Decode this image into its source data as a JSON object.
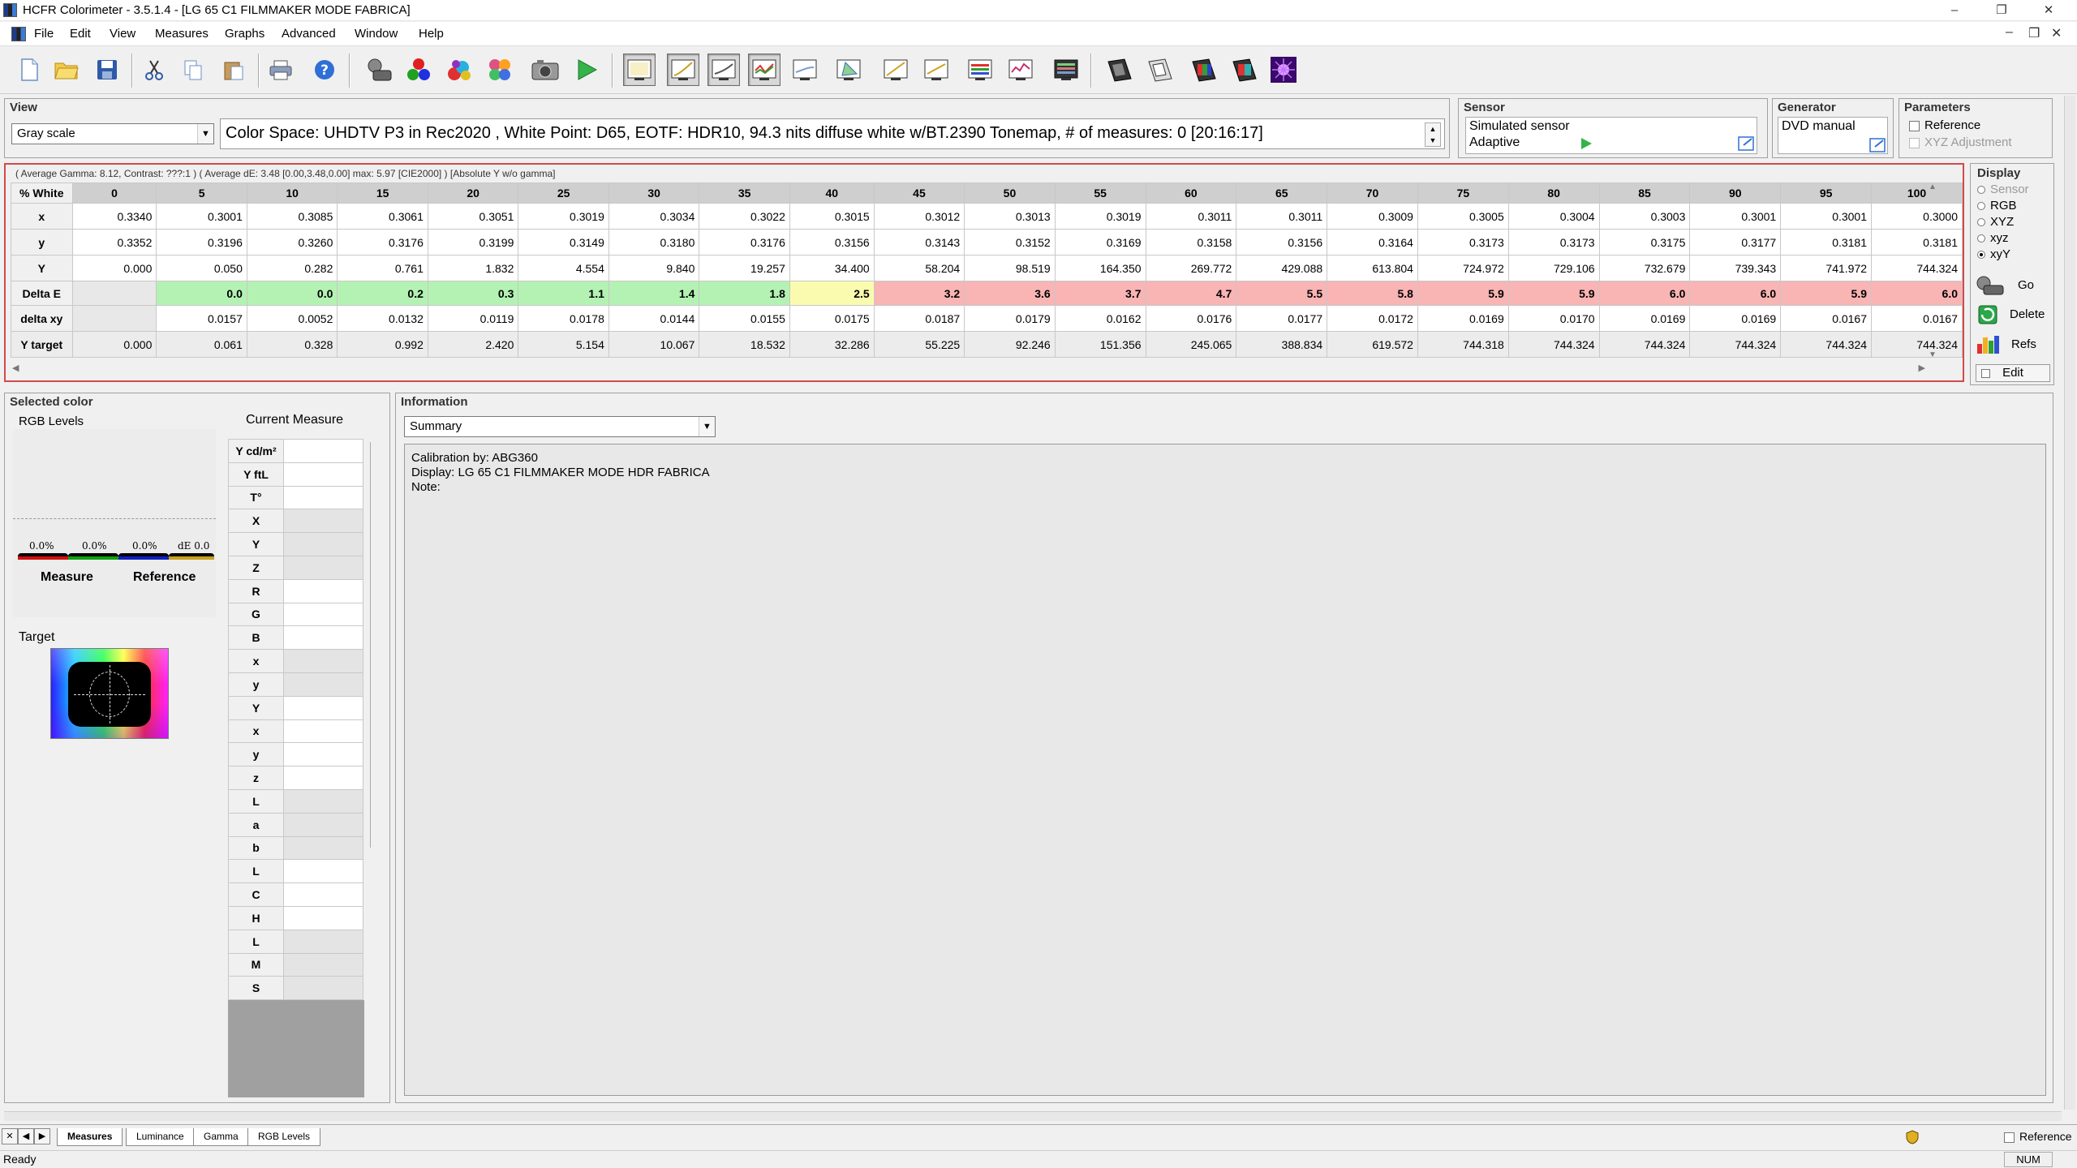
{
  "window": {
    "title": "HCFR Colorimeter - 3.5.1.4 - [LG 65 C1 FILMMAKER MODE FABRICA]",
    "controls": [
      "–",
      "❐",
      "✕"
    ]
  },
  "menu": {
    "items": [
      "File",
      "Edit",
      "View",
      "Measures",
      "Graphs",
      "Advanced",
      "Window",
      "Help"
    ],
    "mdi_controls": [
      "–",
      "❐",
      "✕"
    ]
  },
  "toolbar": {
    "buttons": [
      "new-icon",
      "open-icon",
      "save-icon",
      "cut-icon",
      "copy-icon",
      "paste-icon",
      "print-icon",
      "help-icon",
      "sensor-icon",
      "rgb-circles-icon",
      "color-pattern-icon",
      "saturation-icon",
      "camera-icon",
      "play-icon",
      "gray-scale-view-icon",
      "gamma-view-icon",
      "luminance-view-icon",
      "rgb-levels-view-icon",
      "color-temp-view-icon",
      "cie-chart-view-icon",
      "near-black-view-icon",
      "near-white-view-icon",
      "saturation-luma-view-icon",
      "saturation-shift-view-icon",
      "measures-combo-icon",
      "film-icon-1",
      "film-icon-2",
      "film-icon-3",
      "film-icon-4",
      "purple-burst-icon"
    ]
  },
  "view_panel": {
    "title": "View",
    "selection": "Gray scale",
    "colorspace_text": "Color Space: UHDTV P3 in Rec2020 , White Point: D65, EOTF:  HDR10, 94.3 nits diffuse white w/BT.2390 Tonemap, # of measures: 0 [20:16:17]"
  },
  "sensor_panel": {
    "title": "Sensor",
    "sensor_name": "Simulated sensor",
    "mode": "Adaptive"
  },
  "generator_panel": {
    "title": "Generator",
    "generator_name": "DVD manual"
  },
  "params_panel": {
    "title": "Parameters",
    "reference_label": "Reference",
    "xyz_adjust_label": "XYZ Adjustment"
  },
  "grid": {
    "stats": "( Average Gamma: 8.12, Contrast: ???:1 ) ( Average dE: 3.48 [0.00,3.48,0.00] max: 5.97 [CIE2000] ) [Absolute Y w/o gamma]",
    "header_label": "% White",
    "columns": [
      "0",
      "5",
      "10",
      "15",
      "20",
      "25",
      "30",
      "35",
      "40",
      "45",
      "50",
      "55",
      "60",
      "65",
      "70",
      "75",
      "80",
      "85",
      "90",
      "95",
      "100"
    ],
    "rows": [
      {
        "label": "x",
        "values": [
          "0.3340",
          "0.3001",
          "0.3085",
          "0.3061",
          "0.3051",
          "0.3019",
          "0.3034",
          "0.3022",
          "0.3015",
          "0.3012",
          "0.3013",
          "0.3019",
          "0.3011",
          "0.3011",
          "0.3009",
          "0.3005",
          "0.3004",
          "0.3003",
          "0.3001",
          "0.3001",
          "0.3000"
        ]
      },
      {
        "label": "y",
        "values": [
          "0.3352",
          "0.3196",
          "0.3260",
          "0.3176",
          "0.3199",
          "0.3149",
          "0.3180",
          "0.3176",
          "0.3156",
          "0.3143",
          "0.3152",
          "0.3169",
          "0.3158",
          "0.3156",
          "0.3164",
          "0.3173",
          "0.3173",
          "0.3175",
          "0.3177",
          "0.3181",
          "0.3181"
        ]
      },
      {
        "label": "Y",
        "values": [
          "0.000",
          "0.050",
          "0.282",
          "0.761",
          "1.832",
          "4.554",
          "9.840",
          "19.257",
          "34.400",
          "58.204",
          "98.519",
          "164.350",
          "269.772",
          "429.088",
          "613.804",
          "724.972",
          "729.106",
          "732.679",
          "739.343",
          "741.972",
          "744.324"
        ]
      },
      {
        "label": "Delta E",
        "kind": "deltae",
        "values": [
          "",
          "0.0",
          "0.0",
          "0.2",
          "0.3",
          "1.1",
          "1.4",
          "1.8",
          "2.5",
          "3.2",
          "3.6",
          "3.7",
          "4.7",
          "5.5",
          "5.8",
          "5.9",
          "5.9",
          "6.0",
          "6.0",
          "5.9",
          "6.0"
        ]
      },
      {
        "label": "delta xy",
        "values": [
          "",
          "0.0157",
          "0.0052",
          "0.0132",
          "0.0119",
          "0.0178",
          "0.0144",
          "0.0155",
          "0.0175",
          "0.0187",
          "0.0179",
          "0.0162",
          "0.0176",
          "0.0177",
          "0.0172",
          "0.0169",
          "0.0170",
          "0.0169",
          "0.0169",
          "0.0167",
          "0.0167"
        ]
      },
      {
        "label": "Y target",
        "kind": "target",
        "values": [
          "0.000",
          "0.061",
          "0.328",
          "0.992",
          "2.420",
          "5.154",
          "10.067",
          "18.532",
          "32.286",
          "55.225",
          "92.246",
          "151.356",
          "245.065",
          "388.834",
          "619.572",
          "744.318",
          "744.324",
          "744.324",
          "744.324",
          "744.324",
          "744.324"
        ]
      }
    ],
    "deltae_colors": {
      "good": "#b4f2b4",
      "warn": "#fbfbb0",
      "bad": "#f9b4b4"
    }
  },
  "display_panel": {
    "title": "Display",
    "options": [
      "Sensor",
      "RGB",
      "XYZ",
      "xyz",
      "xyY"
    ],
    "selected": "xyY",
    "buttons": {
      "go": "Go",
      "delete": "Delete",
      "refs": "Refs",
      "edit": "Edit"
    }
  },
  "selected_color": {
    "title": "Selected color",
    "rgb_levels_label": "RGB Levels",
    "current_measure_label": "Current Measure",
    "bar_labels": [
      "0.0%",
      "0.0%",
      "0.0%",
      "dE 0.0"
    ],
    "measure_label": "Measure",
    "reference_label": "Reference",
    "target_label": "Target",
    "measure_rows": [
      "Y cd/m²",
      "Y ftL",
      "T°",
      "X",
      "Y",
      "Z",
      "R",
      "G",
      "B",
      "x",
      "y",
      "Y",
      "x",
      "y",
      "z",
      "L",
      "a",
      "b",
      "L",
      "C",
      "H",
      "L",
      "M",
      "S"
    ]
  },
  "info_panel": {
    "title": "Information",
    "selection": "Summary",
    "lines": [
      "Calibration by: ABG360",
      "Display: LG 65 C1 FILMMAKER MODE HDR FABRICA",
      "Note:"
    ]
  },
  "tabs": {
    "items": [
      "Measures",
      "Luminance",
      "Gamma",
      "RGB Levels"
    ],
    "active": "Measures",
    "reference_label": "Reference"
  },
  "status": {
    "text": "Ready",
    "num": "NUM"
  }
}
